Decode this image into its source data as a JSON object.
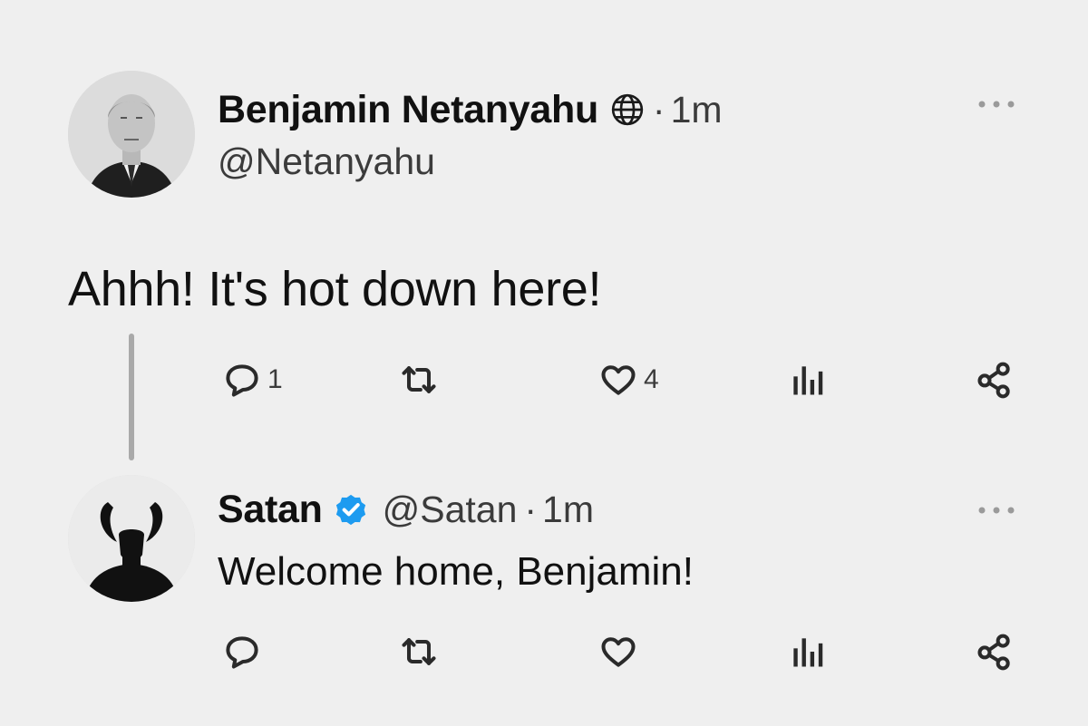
{
  "tweet": {
    "author_name": "Benjamin Netanyahu",
    "author_handle": "@Netanyahu",
    "separator": "·",
    "time": "1m",
    "text": "Ahhh! It's hot down here!",
    "reply_count": "1",
    "like_count": "4",
    "icons": {
      "badge": "globe-icon",
      "more": "more-icon",
      "reply": "reply-icon",
      "retweet": "retweet-icon",
      "like": "like-icon",
      "views": "views-icon",
      "share": "share-icon"
    }
  },
  "reply": {
    "author_name": "Satan",
    "author_handle": "@Satan",
    "separator": "·",
    "time": "1m",
    "text": "Welcome home, Benjamin!",
    "icons": {
      "badge": "verified-icon",
      "more": "more-icon",
      "reply": "reply-icon",
      "retweet": "retweet-icon",
      "like": "like-icon",
      "views": "views-icon",
      "share": "share-icon"
    }
  },
  "colors": {
    "background": "#efefef",
    "text": "#111111",
    "secondary_text": "#3b3b3b",
    "verified_blue": "#1d9bf0",
    "thread_line": "#a9a9a9"
  }
}
